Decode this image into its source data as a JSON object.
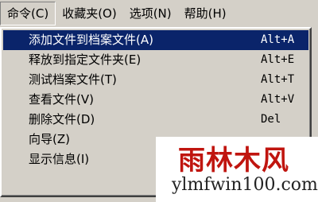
{
  "menubar": {
    "items": [
      {
        "label": "命令(C)"
      },
      {
        "label": "收藏夹(O)"
      },
      {
        "label": "选项(N)"
      },
      {
        "label": "帮助(H)"
      }
    ]
  },
  "dropdown": {
    "items": [
      {
        "label": "添加文件到档案文件(A)",
        "shortcut": "Alt+A"
      },
      {
        "label": "释放到指定文件夹(E)",
        "shortcut": "Alt+E"
      },
      {
        "label": "测试档案文件(T)",
        "shortcut": "Alt+T"
      },
      {
        "label": "查看文件(V)",
        "shortcut": "Alt+V"
      },
      {
        "label": "删除文件(D)",
        "shortcut": "Del"
      },
      {
        "label": "向导(Z)",
        "shortcut": ""
      },
      {
        "label": "显示信息(I)",
        "shortcut": ""
      }
    ]
  },
  "watermark": {
    "logo": "雨林木风",
    "url": "ylmfwin100.com"
  }
}
